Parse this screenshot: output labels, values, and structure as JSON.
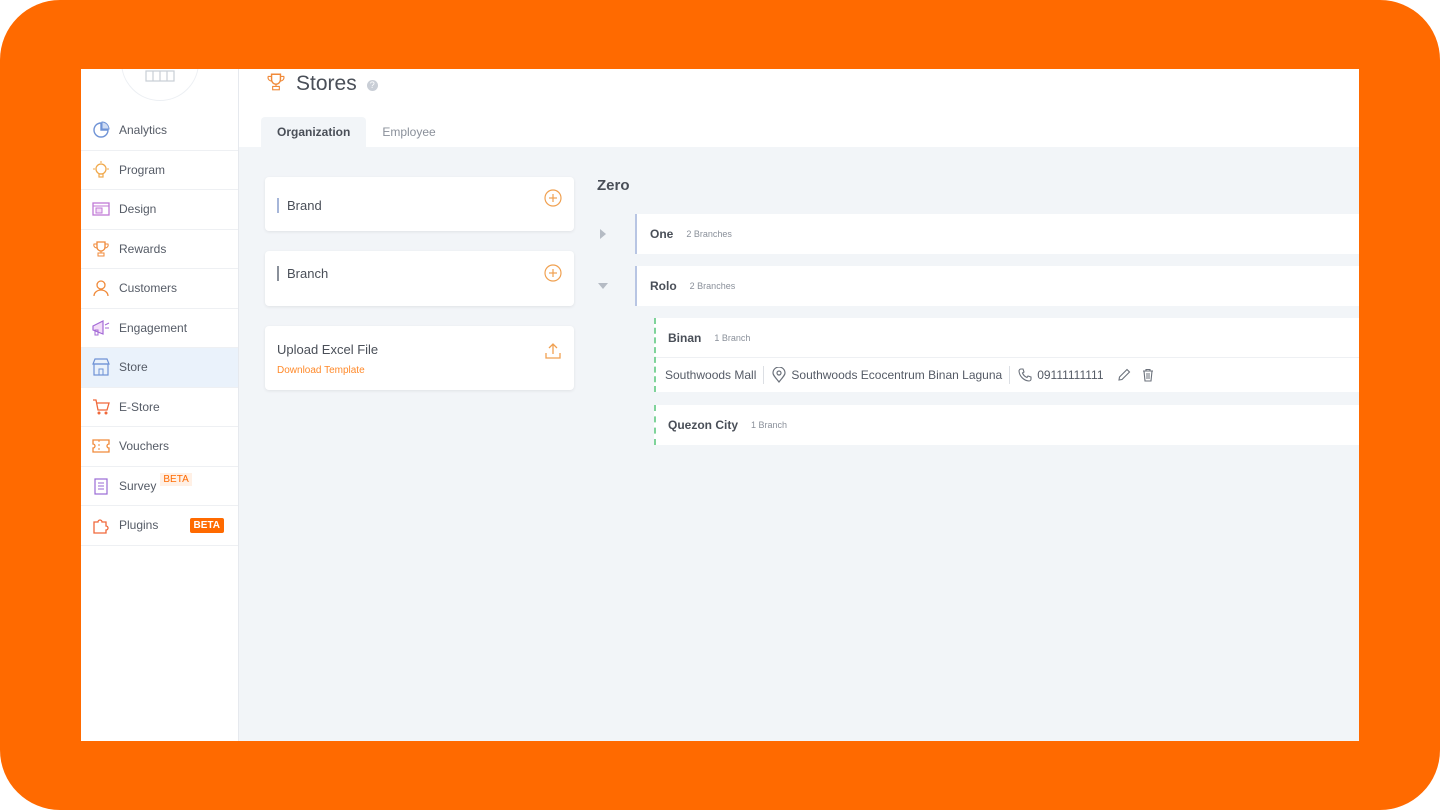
{
  "colors": {
    "frame": "#ff6a00",
    "accent": "#ff6a00",
    "active_bg": "#eaf2fb"
  },
  "sidebar": {
    "items": [
      {
        "label": "Analytics",
        "icon": "pie-chart-icon"
      },
      {
        "label": "Program",
        "icon": "lightbulb-icon"
      },
      {
        "label": "Design",
        "icon": "design-icon"
      },
      {
        "label": "Rewards",
        "icon": "trophy-icon"
      },
      {
        "label": "Customers",
        "icon": "user-icon"
      },
      {
        "label": "Engagement",
        "icon": "megaphone-icon"
      },
      {
        "label": "Store",
        "icon": "store-icon",
        "active": true
      },
      {
        "label": "E-Store",
        "icon": "cart-icon"
      },
      {
        "label": "Vouchers",
        "icon": "ticket-icon"
      },
      {
        "label": "Survey",
        "icon": "clipboard-icon",
        "badge": "BETA"
      },
      {
        "label": "Plugins",
        "icon": "puzzle-icon",
        "badge": "BETA"
      }
    ]
  },
  "header": {
    "title": "Stores",
    "help": "?",
    "tabs": [
      {
        "label": "Organization",
        "active": true
      },
      {
        "label": "Employee"
      }
    ]
  },
  "left_panel": {
    "brand_label": "Brand",
    "branch_label": "Branch",
    "upload_title": "Upload Excel File",
    "upload_link": "Download Template"
  },
  "tree": {
    "title": "Zero",
    "brands": [
      {
        "name": "One",
        "count": "2 Branches",
        "expanded": false
      },
      {
        "name": "Rolo",
        "count": "2 Branches",
        "expanded": true
      }
    ],
    "branches": [
      {
        "name": "Binan",
        "count": "1 Branch",
        "store": {
          "name": "Southwoods Mall",
          "address": "Southwoods Ecocentrum Binan Laguna",
          "phone": "09111111111"
        }
      },
      {
        "name": "Quezon City",
        "count": "1 Branch"
      }
    ]
  }
}
